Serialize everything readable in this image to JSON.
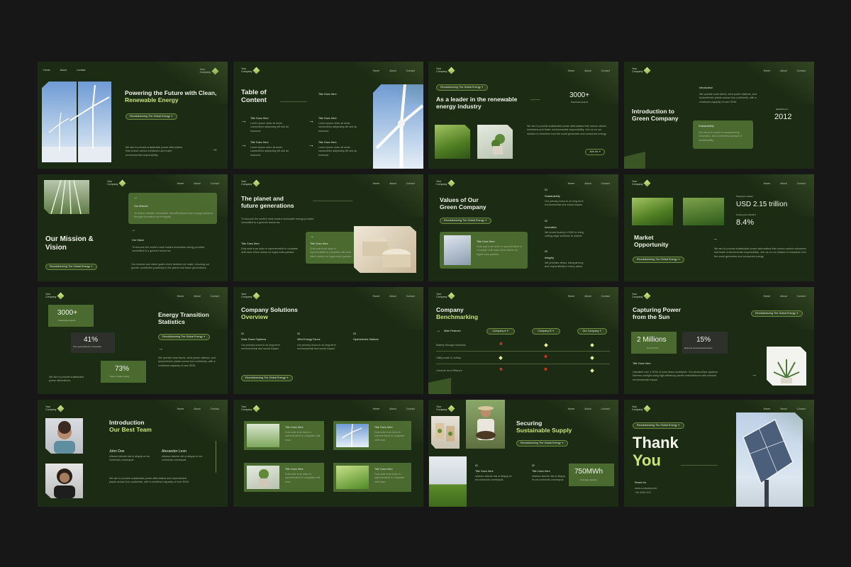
{
  "common": {
    "logo_line1": "Your",
    "logo_line2": "Company",
    "nav": [
      "Home",
      "About",
      "Contact"
    ],
    "pill": "Revolutionizing The Global Energy",
    "title_goes_here": "Title Goes Here",
    "lorem": "Duis aute irure dolor in reprehenderit in voluptate velit esse cillum dolore eu fugiat nulla pariatur.",
    "short_lorem": "Lorem ipsum dolor sit amet, consectetur adipiscing elit sed do eiusmod."
  },
  "s1": {
    "title1": "Powering the Future with Clean,",
    "title2": "Renewable Energy",
    "body": "We aim to provide sustainable power alternatives that reduce carbon emissions and foster environmental responsibility."
  },
  "s2": {
    "title1": "Table of",
    "title2": "Content"
  },
  "s3": {
    "title1": "As a leader in the renewable",
    "title2": "energy industry",
    "stat": "3000+",
    "stat_label": "Passionate Experts",
    "body": "We aim to provide sustainable power alternatives that reduce carbon emissions and foster environmental responsibility. Join us on our mission to transform how the world generates and consumes energy.",
    "btn": "Join Us"
  },
  "s4": {
    "title1": "Introduction to",
    "title2": "Green Company",
    "intro_h": "Introduction",
    "intro_b": "We operate solar farms, wind power stations, and hydroelectric plants across four continents, with a combined capacity of over 5GW.",
    "est": "Established in",
    "year": "2012",
    "sus_h": "Sustainability",
    "sus_b": "Our ethos is rooted in transparency, innovation, and a relentless pursuit of sustainability."
  },
  "s5": {
    "title1": "Our Mission &",
    "title2": "Vision",
    "m_h": "Our Mission",
    "m_b": "To deliver reliable, accessible, and affordable clean energy solutions through innovation and integrity.",
    "v_h": "Our Vision",
    "v_b": "To become the world's most trusted renewable energy provider, committed to a greener tomorrow.",
    "body": "Our mission and vision guide every decision we make, ensuring our growth contributes positively to the planet and future generations."
  },
  "s6": {
    "title1": "The planet and",
    "title2": "future generations",
    "body": "To become the world's most trusted renewable energy provider, committed to a greener tomorrow."
  },
  "s7": {
    "title1": "Values of Our",
    "title2": "Green Company",
    "items": [
      {
        "n": "01",
        "h": "Sustainability",
        "b": "Our primary focus is on long-term environmental and social impact."
      },
      {
        "n": "02",
        "h": "Innovation",
        "b": "We invest heavily in R&D to bring cutting-edge solutions to market."
      },
      {
        "n": "03",
        "h": "Integrity",
        "b": "We prioritize ethics, transparency, and responsibility in every action."
      }
    ]
  },
  "s8": {
    "title1": "Market",
    "title2": "Opportunity",
    "proj": "Projected to Reach",
    "usd": "USD 2.15 trillion",
    "cagr_l": "Growing at a CAGR of",
    "cagr": "8.4%",
    "body": "We aim to provide sustainable power alternatives that reduce carbon emissions and foster environmental responsibility. Join us on our mission to transform how the world generates and consumes energy."
  },
  "s9": {
    "title1": "Energy Transition",
    "title2": "Statistics",
    "a": "3000+",
    "a_l": "Passionate Experts",
    "b": "41%",
    "b_l": "From generated from renewable",
    "c": "73%",
    "c_l": "Invest in clean energy",
    "body": "We operate solar farms, wind power stations, and hydroelectric plants across four continents, with a combined capacity of over 5GW.",
    "foot": "We aim to provide sustainable power alternatives."
  },
  "s10": {
    "title1": "Company Solutions",
    "title2": "Overview",
    "items": [
      {
        "n": "01",
        "h": "Solar Power Systems"
      },
      {
        "n": "02",
        "h": "Wind Energy Farms"
      },
      {
        "n": "03",
        "h": "Hydroelectric Stations"
      }
    ],
    "b": "Our primary focus is on long-term environmental and social impact."
  },
  "s11": {
    "title1": "Company",
    "title2": "Benchmarking",
    "main": "Main Features",
    "cols": [
      "Company A",
      "Company B",
      "Our Company"
    ],
    "rows": [
      "Battery Storage Solutions",
      "Utility-scale & rooftop",
      "Onshore And Offshore"
    ]
  },
  "s12": {
    "title1": "Capturing Power",
    "title2": "from the Sun",
    "a": "2 Millions",
    "a_l": "Tons Of CO2",
    "b": "15%",
    "b_l": "Reduced Operational Downtime",
    "h": "Title Goes Here",
    "body": "Operates over 1.5GW of solar farms worldwide. Our photovoltaic systems harness sunlight using high-efficiency panels manufactured with minimal environmental impact."
  },
  "s13": {
    "title1": "Introduction",
    "title2": "Our Best Team",
    "p1": "John Doe",
    "p2": "Alexander Leon",
    "role": "ullamco laboris nisi ut aliquip ex ea commodo consequat.",
    "body": "We aim to provide sustainable power alternatives and hydroelectric plants across four continents, with a combined capacity of over 5GW."
  },
  "s14": {
    "b": "Duis aute irure dolor in reprehenderit in voluptate velit esse."
  },
  "s15": {
    "title1": "Securing",
    "title2": "Sustainable Supply",
    "stat": "750MWh",
    "stat_l": "of storage capacity",
    "items": [
      {
        "n": "01",
        "h": "Title Goes Here"
      },
      {
        "n": "02",
        "h": "Title Goes Here"
      }
    ],
    "b": "ullamco laboris nisi ut aliquip ex ea commodo consequat."
  },
  "s16": {
    "t1": "Thank",
    "t2": "You",
    "reach": "Reach Us",
    "email": "www.company.com",
    "phone": "+44 4000 100"
  }
}
